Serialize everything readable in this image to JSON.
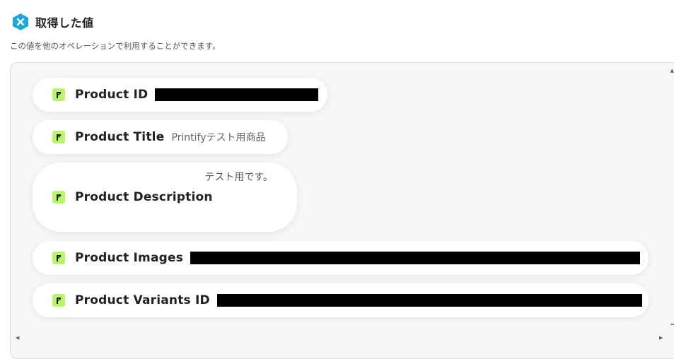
{
  "header": {
    "title": "取得した値",
    "icon": "yoom-logo-icon"
  },
  "subtitle": "この値を他のオペレーションで利用することができます。",
  "items": [
    {
      "label": "Product ID",
      "value": "",
      "redacted": true
    },
    {
      "label": "Product Title",
      "value": "Printifyテスト用商品",
      "redacted": false
    },
    {
      "label": "Product Description",
      "value": "テスト用です。",
      "redacted": false
    },
    {
      "label": "Product Images",
      "value": "",
      "redacted": true
    },
    {
      "label": "Product Variants ID",
      "value": "",
      "redacted": true
    }
  ],
  "colors": {
    "item_icon_bg": "#b9f46a",
    "header_icon_bg": "#1aa9d8"
  }
}
